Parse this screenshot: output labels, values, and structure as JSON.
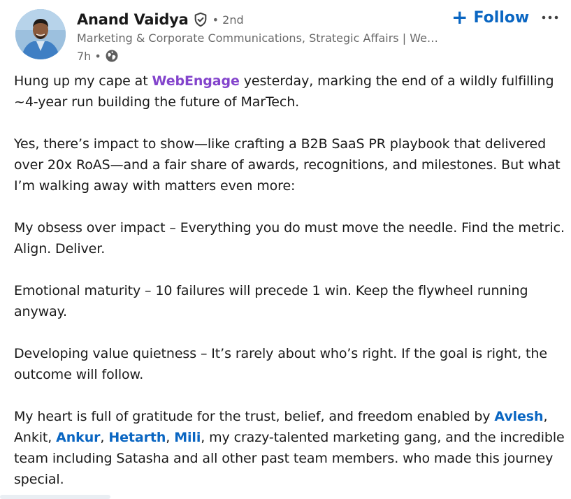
{
  "author": {
    "name": "Anand Vaidya",
    "degree": "• 2nd",
    "headline": "Marketing & Corporate Communications, Strategic Affairs | Web…",
    "time": "7h •",
    "visibility_icon": "globe-icon",
    "badge_icon": "verified-shield-icon"
  },
  "actions": {
    "follow_plus": "+",
    "follow_label": "Follow",
    "more_icon": "ellipsis-icon"
  },
  "colors": {
    "accent": "#0a66c2",
    "company_mention": "#8344cc",
    "text": "#191919",
    "muted": "#666666"
  },
  "post": {
    "p1": {
      "before": "Hung up my cape at ",
      "company": "WebEngage",
      "after": " yesterday, marking the end of a wildly fulfilling ~4-year run building the future of MarTech."
    },
    "p2": "Yes, there’s impact to show—like crafting a B2B SaaS PR playbook that delivered over 20x RoAS—and a fair share of awards, recognitions, and milestones. But what I’m walking away with matters even more:",
    "p3": "My obsess over impact – Everything you do must move the needle. Find the metric. Align. Deliver.",
    "p4": "Emotional maturity – 10 failures will precede 1 win. Keep the flywheel running anyway.",
    "p5": "Developing value quietness – It’s rarely about who’s right. If the goal is right, the outcome will follow.",
    "p6": {
      "t1": "My heart is full of gratitude for the trust, belief, and freedom enabled by ",
      "m1": "Avlesh",
      "t2": ", Ankit, ",
      "m2": "Ankur",
      "t3": ", ",
      "m3": "Hetarth",
      "t4": ", ",
      "m4": "Mili",
      "t5": ", my crazy-talented marketing gang, and the incredible team including Satasha and all other past team members. who made this journey special."
    }
  }
}
